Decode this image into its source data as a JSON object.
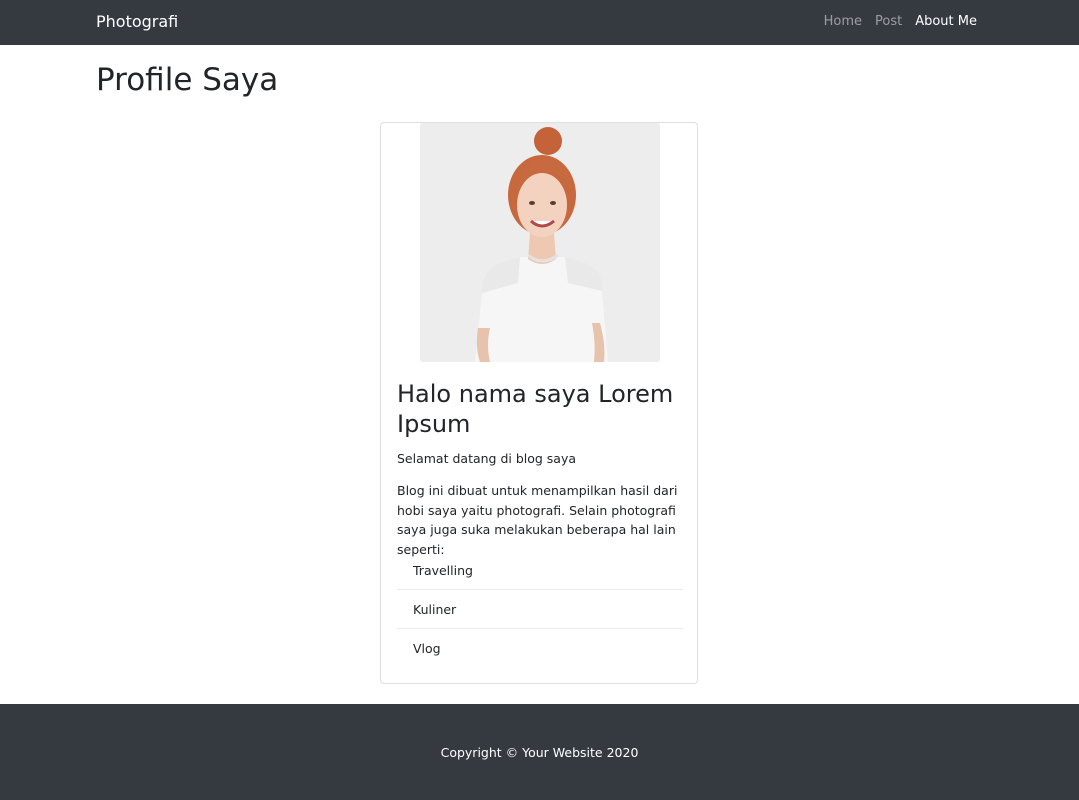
{
  "navbar": {
    "brand": "Photografi",
    "links": [
      {
        "label": "Home",
        "active": false
      },
      {
        "label": "Post",
        "active": false
      },
      {
        "label": "About Me",
        "active": true
      }
    ]
  },
  "main": {
    "page_title": "Profile Saya",
    "card": {
      "title": "Halo nama saya Lorem Ipsum",
      "subtitle": "Selamat datang di blog saya",
      "text": "Blog ini dibuat untuk menampilkan hasil dari hobi saya yaitu photografi. Selain photografi saya juga suka melakukan beberapa hal lain seperti:",
      "hobbies": [
        "Travelling",
        "Kuliner",
        "Vlog"
      ]
    }
  },
  "footer": {
    "copyright": "Copyright © Your Website 2020"
  },
  "colors": {
    "navbar_bg": "#343a40",
    "footer_bg": "#343a40",
    "text": "#212529",
    "nav_inactive": "rgba(255,255,255,0.5)",
    "nav_active": "#ffffff"
  }
}
